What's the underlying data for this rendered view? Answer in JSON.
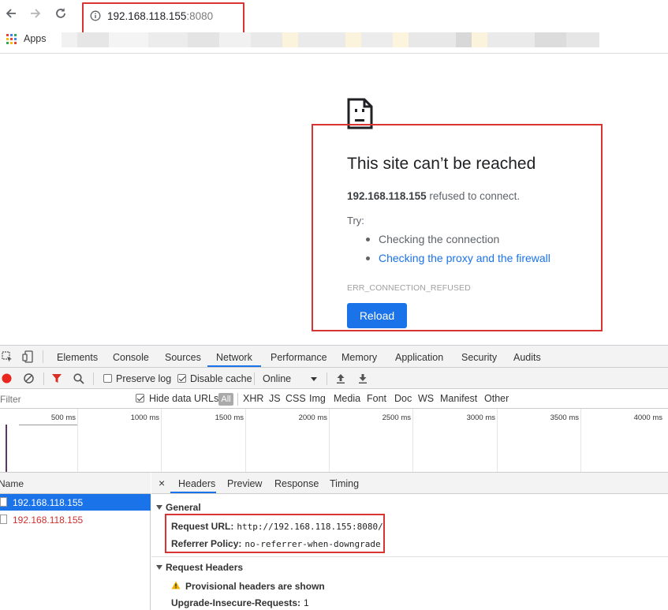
{
  "browser": {
    "url_host": "192.168.118.155",
    "url_port": ":8080",
    "bookmarks_label": "Apps"
  },
  "error_page": {
    "title": "This site can’t be reached",
    "host": "192.168.118.155",
    "message": " refused to connect.",
    "try_label": "Try:",
    "suggestions": [
      "Checking the connection",
      "Checking the proxy and the firewall"
    ],
    "error_code": "ERR_CONNECTION_REFUSED",
    "reload_label": "Reload",
    "colors": {
      "link": "#1a73e8",
      "button": "#1a73e8",
      "highlight_box": "#d93434"
    }
  },
  "devtools": {
    "tabs": [
      "Elements",
      "Console",
      "Sources",
      "Network",
      "Performance",
      "Memory",
      "Application",
      "Security",
      "Audits"
    ],
    "active_tab": "Network",
    "toolbar": {
      "preserve_log": "Preserve log",
      "preserve_log_checked": false,
      "disable_cache": "Disable cache",
      "disable_cache_checked": true,
      "throttling": "Online"
    },
    "filter_bar": {
      "filter_placeholder": "Filter",
      "hide_data_urls": "Hide data URLs",
      "hide_data_urls_checked": true,
      "types": [
        "All",
        "XHR",
        "JS",
        "CSS",
        "Img",
        "Media",
        "Font",
        "Doc",
        "WS",
        "Manifest",
        "Other"
      ]
    },
    "overview_ticks": [
      "500 ms",
      "1000 ms",
      "1500 ms",
      "2000 ms",
      "2500 ms",
      "3000 ms",
      "3500 ms",
      "4000 ms"
    ],
    "requests": {
      "column_name": "Name",
      "rows": [
        {
          "name": "192.168.118.155",
          "selected": true,
          "failed": false
        },
        {
          "name": "192.168.118.155",
          "selected": false,
          "failed": true
        }
      ]
    },
    "detail": {
      "close": "×",
      "tabs": [
        "Headers",
        "Preview",
        "Response",
        "Timing"
      ],
      "active_tab": "Headers",
      "general_title": "General",
      "request_url_key": "Request URL:",
      "request_url_value": "http://192.168.118.155:8080/",
      "referrer_key": "Referrer Policy:",
      "referrer_value": "no-referrer-when-downgrade",
      "request_headers_title": "Request Headers",
      "provisional_warning": "Provisional headers are shown",
      "upgrade_key": "Upgrade-Insecure-Requests:",
      "upgrade_value": "1"
    }
  }
}
